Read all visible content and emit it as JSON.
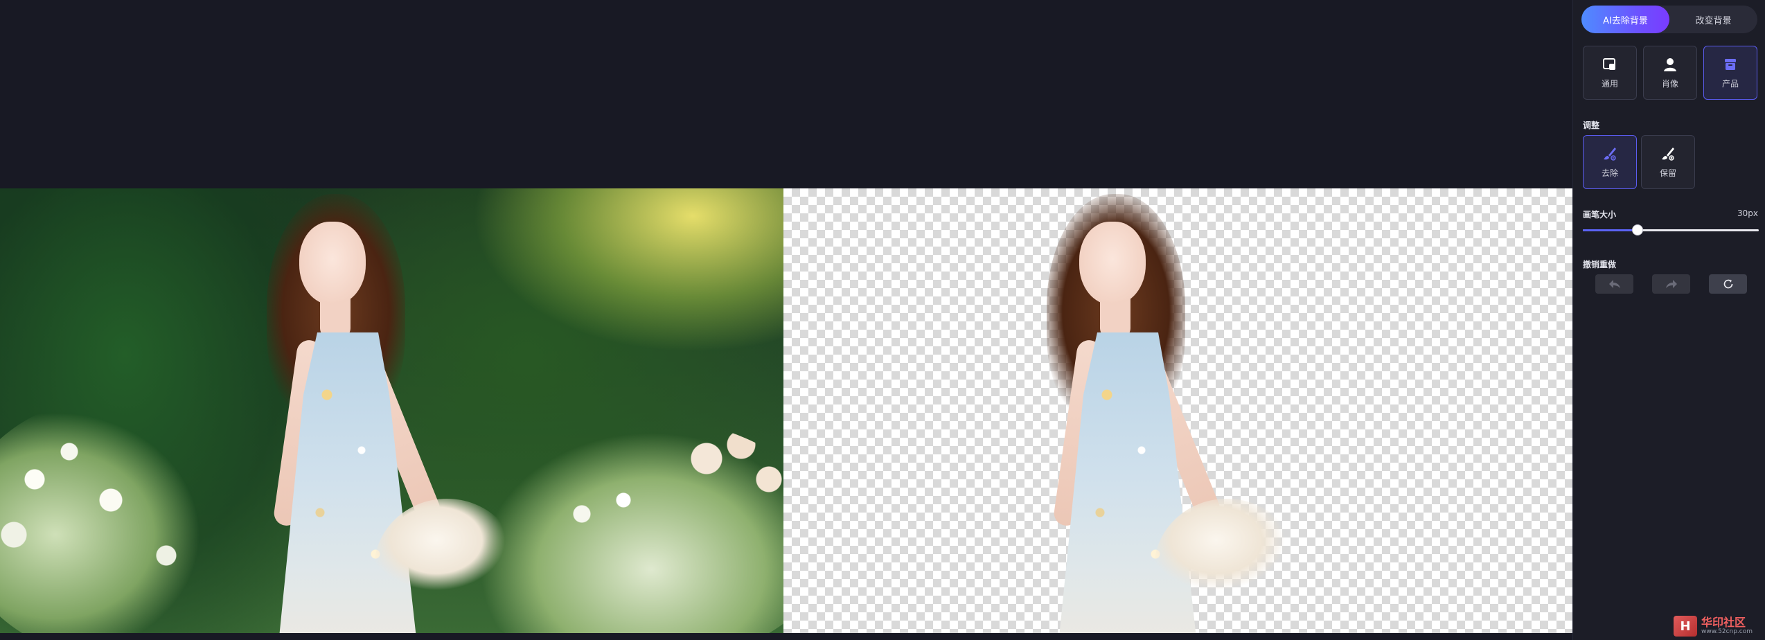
{
  "colors": {
    "accent": "#5b5cf0",
    "tab_gradient_start": "#4f8cff",
    "tab_gradient_end": "#7a3cff",
    "background": "#181924",
    "sidebar": "#1c1d27"
  },
  "tabs": [
    {
      "label": "AI去除背景",
      "active": true
    },
    {
      "label": "改变背景",
      "active": false
    }
  ],
  "modes": [
    {
      "label": "通用",
      "icon": "image-general-icon",
      "active": false
    },
    {
      "label": "肖像",
      "icon": "portrait-icon",
      "active": false
    },
    {
      "label": "产品",
      "icon": "product-icon",
      "active": true
    }
  ],
  "adjust": {
    "title": "调整",
    "brushes": [
      {
        "label": "去除",
        "icon": "brush-erase-icon",
        "active": true
      },
      {
        "label": "保留",
        "icon": "brush-keep-icon",
        "active": false
      }
    ]
  },
  "brush_size": {
    "title": "画笔大小",
    "value_label": "30px",
    "fraction": 0.31
  },
  "history": {
    "title": "撤销重做",
    "buttons": [
      {
        "name": "undo",
        "icon": "undo-icon"
      },
      {
        "name": "redo",
        "icon": "redo-icon"
      },
      {
        "name": "reset",
        "icon": "reset-icon"
      }
    ]
  },
  "watermark": {
    "logo_char": "H",
    "title": "华印社区",
    "url": "www.52cnp.com"
  }
}
